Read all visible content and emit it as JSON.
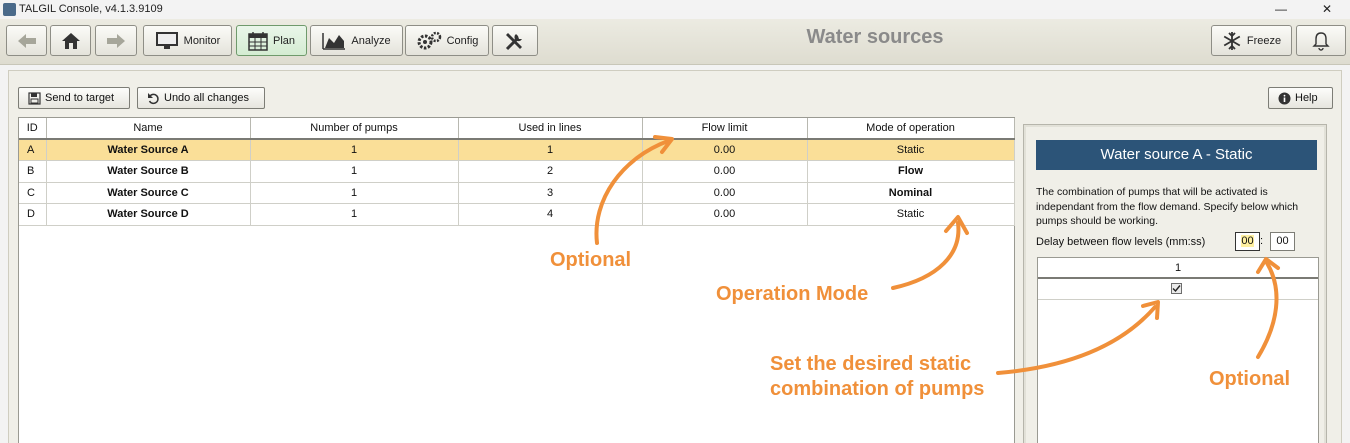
{
  "window": {
    "title": "TALGIL Console, v4.1.3.9109",
    "controls": [
      "—",
      "❐",
      "✕"
    ]
  },
  "toolbar": {
    "back_icon": "arrow-left-icon",
    "home_icon": "home-icon",
    "forward_icon": "arrow-right-icon",
    "monitor": "Monitor",
    "plan": "Plan",
    "analyze": "Analyze",
    "config": "Config",
    "tools_icon": "tools-icon",
    "freeze": "Freeze",
    "bell_icon": "bell-icon"
  },
  "page": {
    "title": "Water sources"
  },
  "actions": {
    "send": "Send to target",
    "undo": "Undo all changes",
    "help": "Help"
  },
  "table": {
    "columns": [
      "ID",
      "Name",
      "Number of pumps",
      "Used in lines",
      "Flow limit",
      "Mode of operation"
    ],
    "rows": [
      {
        "id": "A",
        "name": "Water Source A",
        "pumps": "1",
        "lines": "1",
        "flow": "0.00",
        "mode": "Static",
        "selected": true
      },
      {
        "id": "B",
        "name": "Water Source B",
        "pumps": "1",
        "lines": "2",
        "flow": "0.00",
        "mode": "Flow",
        "mode_bold": true
      },
      {
        "id": "C",
        "name": "Water Source C",
        "pumps": "1",
        "lines": "3",
        "flow": "0.00",
        "mode": "Nominal",
        "mode_bold": true
      },
      {
        "id": "D",
        "name": "Water Source D",
        "pumps": "1",
        "lines": "4",
        "flow": "0.00",
        "mode": "Static"
      }
    ]
  },
  "detail": {
    "header": "Water source A - Static",
    "description": "The combination of pumps that will be activated is independant from the flow demand. Specify below which pumps should be working.",
    "delay_label": "Delay between flow levels (mm:ss)",
    "delay_minutes": "00",
    "delay_separator": ":",
    "delay_seconds": "00",
    "pump_column": "1",
    "pump_checked": true
  },
  "annotations": {
    "optional_left": "Optional",
    "operation_mode": "Operation Mode",
    "static_line1": "Set the desired static",
    "static_line2": "combination of pumps",
    "optional_right": "Optional",
    "color": "#f0903a"
  },
  "colors": {
    "selected_row": "#fadf98",
    "detail_header": "#2c5478",
    "title_gray": "#8a8a8a"
  }
}
